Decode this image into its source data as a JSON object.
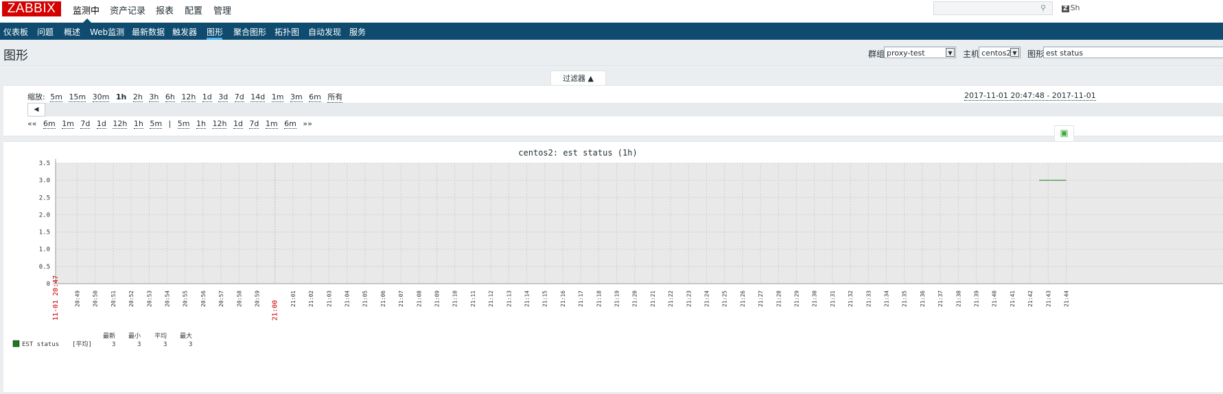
{
  "logo": "ZABBIX",
  "main_menu": [
    {
      "label": "监测中",
      "active": true
    },
    {
      "label": "资产记录"
    },
    {
      "label": "报表"
    },
    {
      "label": "配置"
    },
    {
      "label": "管理"
    }
  ],
  "search": {
    "value": "",
    "placeholder": ""
  },
  "share_label": "Sh",
  "sub_menu": [
    {
      "label": "仪表板"
    },
    {
      "label": "问题"
    },
    {
      "label": "概述"
    },
    {
      "label": "Web监测"
    },
    {
      "label": "最新数据"
    },
    {
      "label": "触发器"
    },
    {
      "label": "图形",
      "active": true
    },
    {
      "label": "聚合图形"
    },
    {
      "label": "拓扑图"
    },
    {
      "label": "自动发现"
    },
    {
      "label": "服务"
    }
  ],
  "page_title": "图形",
  "header_filters": {
    "group_label": "群组",
    "group_value": "proxy-test",
    "host_label": "主机",
    "host_value": "centos2",
    "graph_label": "图形",
    "graph_value": "est status"
  },
  "filter_tab": "过滤器 ▲",
  "zoom": {
    "label": "缩放:",
    "options": [
      "5m",
      "15m",
      "30m",
      "1h",
      "2h",
      "3h",
      "6h",
      "12h",
      "1d",
      "3d",
      "7d",
      "14d",
      "1m",
      "3m",
      "6m",
      "所有"
    ],
    "current": "1h"
  },
  "date_range": "2017-11-01 20:47:48 - 2017-11-01",
  "nav": {
    "back_prefix": "««",
    "back": [
      "6m",
      "1m",
      "7d",
      "1d",
      "12h",
      "1h",
      "5m"
    ],
    "separator": "|",
    "forward": [
      "5m",
      "1h",
      "12h",
      "1d",
      "7d",
      "1m",
      "6m"
    ],
    "forward_suffix": "»»"
  },
  "graph": {
    "title": "centos2: est status (1h)",
    "legend": {
      "headers": [
        "最新",
        "最小",
        "平均",
        "最大"
      ],
      "item_name": "EST status",
      "item_func": "[平均]",
      "values": [
        "3",
        "3",
        "3",
        "3"
      ]
    }
  },
  "chart_data": {
    "type": "line",
    "title": "centos2: est status (1h)",
    "ylim": [
      0,
      3.5
    ],
    "y_ticks": [
      "0",
      "0.5",
      "1.0",
      "1.5",
      "2.0",
      "2.5",
      "3.0",
      "3.5"
    ],
    "x_ticks": [
      "11-01 20:47",
      "20:49",
      "20:50",
      "20:51",
      "20:52",
      "20:53",
      "20:54",
      "20:55",
      "20:56",
      "20:57",
      "20:58",
      "20:59",
      "21:00",
      "21:01",
      "21:02",
      "21:03",
      "21:04",
      "21:05",
      "21:06",
      "21:07",
      "21:08",
      "21:09",
      "21:10",
      "21:11",
      "21:12",
      "21:13",
      "21:14",
      "21:15",
      "21:16",
      "21:17",
      "21:18",
      "21:19",
      "21:20",
      "21:21",
      "21:22",
      "21:23",
      "21:24",
      "21:25",
      "21:26",
      "21:27",
      "21:28",
      "21:29",
      "21:30",
      "21:31",
      "21:32",
      "21:33",
      "21:34",
      "21:35",
      "21:36",
      "21:37",
      "21:38",
      "21:39",
      "21:40",
      "21:41",
      "21:42",
      "21:43",
      "21:44"
    ],
    "highlight_ticks": [
      "11-01 20:47",
      "21:00"
    ],
    "series": [
      {
        "name": "EST status",
        "color": "#1a7c1a",
        "x": [
          "21:42:30",
          "21:44"
        ],
        "values": [
          3,
          3
        ]
      }
    ],
    "grid": true,
    "colors": {
      "plot_bg": "#e9e9e9",
      "grid": "#cfcfcf",
      "highlight": "#cc0000"
    }
  }
}
